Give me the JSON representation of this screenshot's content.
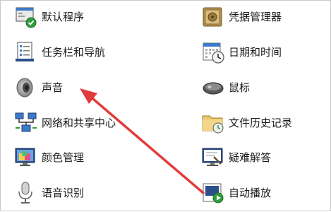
{
  "left_column": [
    {
      "label": "默认程序",
      "icon": "default-programs-icon"
    },
    {
      "label": "任务栏和导航",
      "icon": "taskbar-navigation-icon"
    },
    {
      "label": "声音",
      "icon": "speaker-icon"
    },
    {
      "label": "网络和共享中心",
      "icon": "network-sharing-icon"
    },
    {
      "label": "颜色管理",
      "icon": "color-management-icon"
    },
    {
      "label": "语音识别",
      "icon": "microphone-icon"
    }
  ],
  "right_column": [
    {
      "label": "凭据管理器",
      "icon": "credential-vault-icon"
    },
    {
      "label": "日期和时间",
      "icon": "calendar-clock-icon"
    },
    {
      "label": "鼠标",
      "icon": "mouse-icon"
    },
    {
      "label": "文件历史记录",
      "icon": "file-history-icon"
    },
    {
      "label": "疑难解答",
      "icon": "troubleshooting-icon"
    },
    {
      "label": "自动播放",
      "icon": "autoplay-icon"
    }
  ],
  "annotation": {
    "arrow_color": "#e23b3b"
  }
}
